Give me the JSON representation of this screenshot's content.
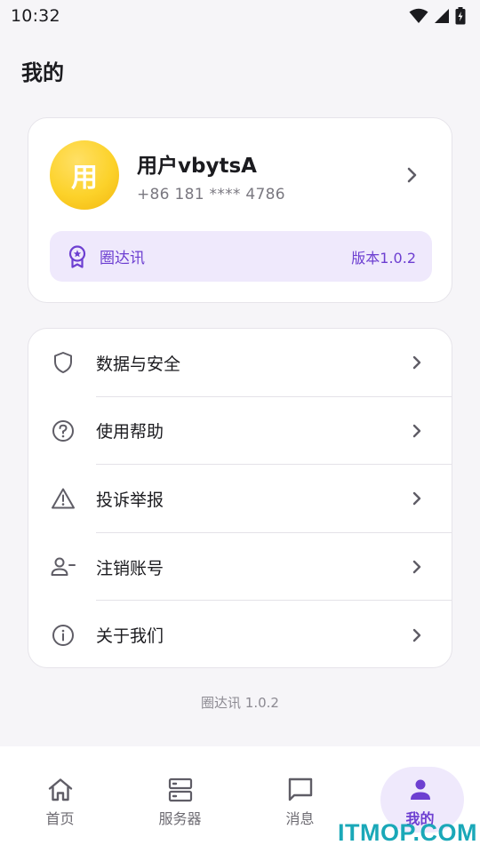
{
  "status_bar": {
    "time": "10:32"
  },
  "page": {
    "title": "我的"
  },
  "profile": {
    "avatar_text": "用",
    "name": "用户vbytsA",
    "phone": "+86 181 **** 4786",
    "app_badge": {
      "name": "圈达讯",
      "version": "版本1.0.2",
      "icon": "award-icon"
    }
  },
  "menu": {
    "items": [
      {
        "label": "数据与安全",
        "icon": "shield-icon"
      },
      {
        "label": "使用帮助",
        "icon": "help-circle-icon"
      },
      {
        "label": "投诉举报",
        "icon": "warning-icon"
      },
      {
        "label": "注销账号",
        "icon": "user-minus-icon"
      },
      {
        "label": "关于我们",
        "icon": "info-icon"
      }
    ]
  },
  "footer": {
    "version_text": "圈达讯 1.0.2"
  },
  "bottom_nav": {
    "items": [
      {
        "label": "首页",
        "icon": "home-icon",
        "active": false
      },
      {
        "label": "服务器",
        "icon": "server-icon",
        "active": false
      },
      {
        "label": "消息",
        "icon": "message-icon",
        "active": false
      },
      {
        "label": "我的",
        "icon": "person-icon",
        "active": true
      }
    ]
  },
  "watermark": {
    "text": "ITMOP.COM"
  },
  "colors": {
    "accent": "#6d3fd1",
    "accent_bg": "#efe9fc",
    "avatar": "#fcd22a",
    "background": "#f6f5f8"
  }
}
